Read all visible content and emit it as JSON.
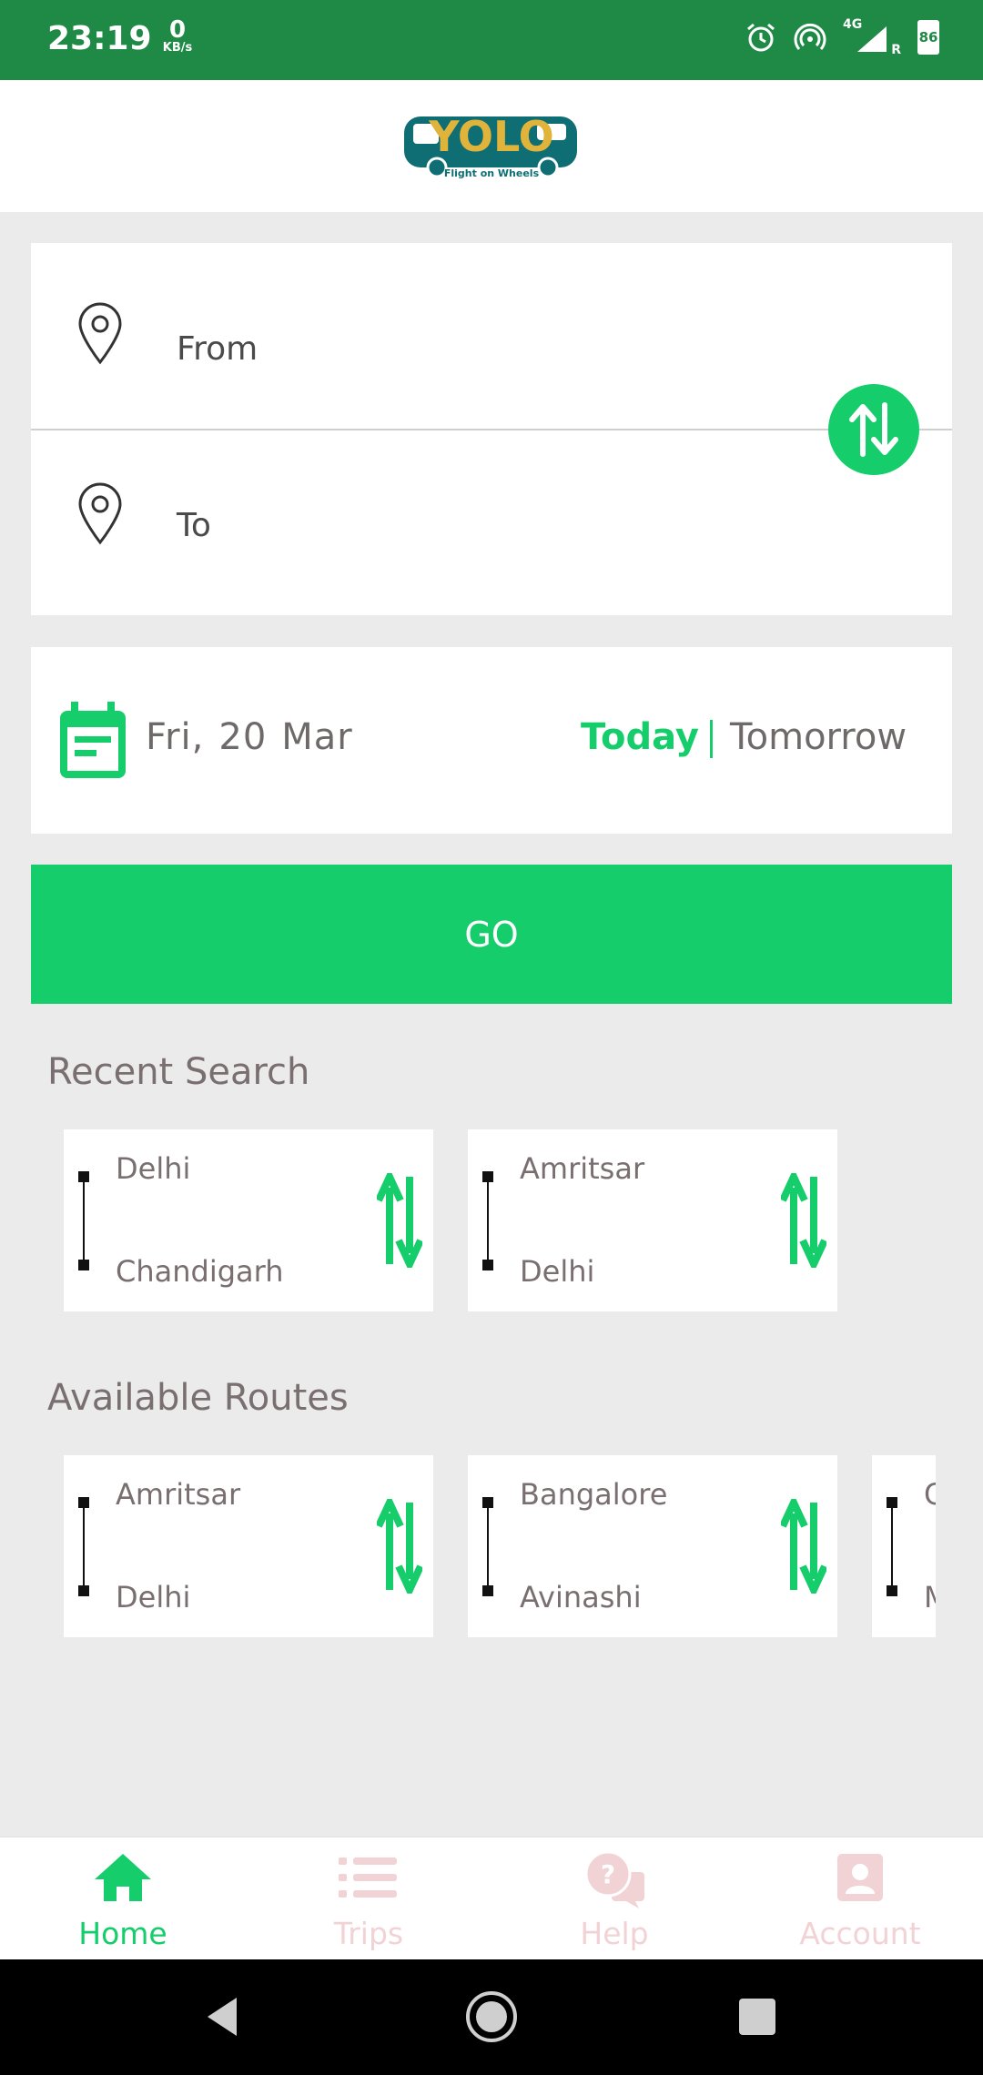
{
  "status_bar": {
    "time": "23:19",
    "net_speed": "0",
    "net_unit": "KB/s",
    "network": "4G",
    "roaming": "R",
    "battery": "86"
  },
  "brand": {
    "name": "YOLO",
    "tagline": "Flight on Wheels",
    "primary_color": "#16cd6b",
    "status_color": "#1f8a46"
  },
  "search": {
    "from_placeholder": "From",
    "to_placeholder": "To",
    "date": {
      "day": "Fri,",
      "date": "20",
      "month": "Mar"
    },
    "today_label": "Today",
    "tomorrow_label": "Tomorrow",
    "go_label": "GO"
  },
  "recent_search": {
    "title": "Recent Search",
    "items": [
      {
        "from": "Delhi",
        "to": "Chandigarh"
      },
      {
        "from": "Amritsar",
        "to": "Delhi"
      }
    ]
  },
  "available_routes": {
    "title": "Available Routes",
    "items": [
      {
        "from": "Amritsar",
        "to": "Delhi"
      },
      {
        "from": "Bangalore",
        "to": "Avinashi"
      },
      {
        "from": "C",
        "to": "M"
      }
    ]
  },
  "bottom_nav": [
    {
      "label": "Home",
      "icon": "home-icon",
      "active": true
    },
    {
      "label": "Trips",
      "icon": "list-icon",
      "active": false
    },
    {
      "label": "Help",
      "icon": "help-chat-icon",
      "active": false
    },
    {
      "label": "Account",
      "icon": "account-icon",
      "active": false
    }
  ]
}
